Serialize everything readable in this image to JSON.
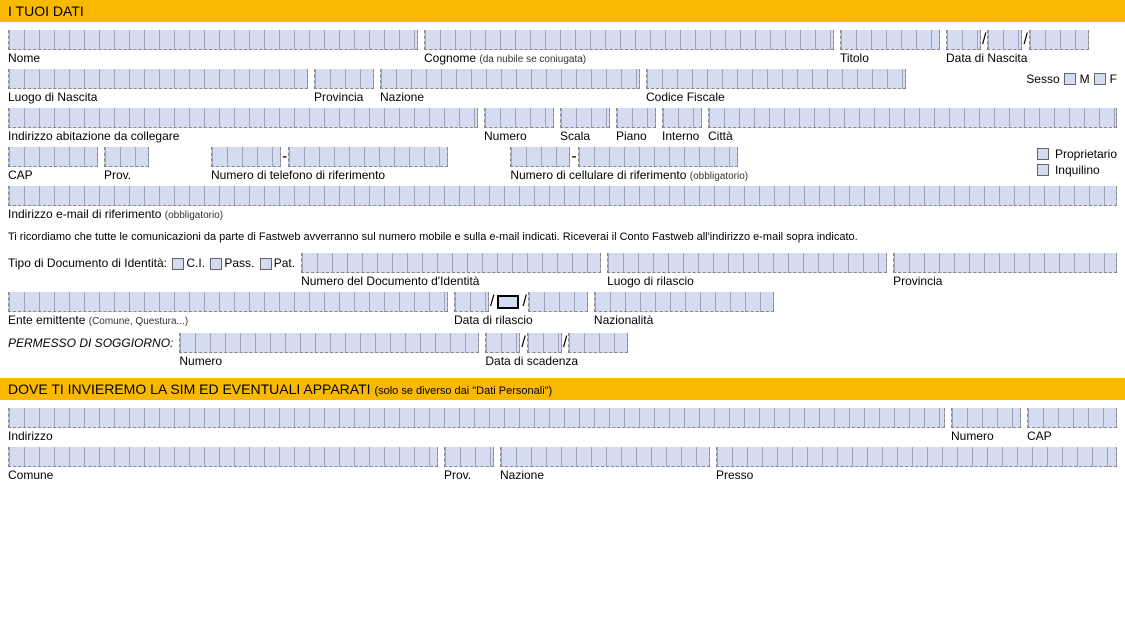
{
  "section1": {
    "title": "I TUOI DATI",
    "nome": "Nome",
    "cognome": "Cognome",
    "cognome_note": "(da nubile se coniugata)",
    "titolo": "Titolo",
    "data_nascita": "Data di Nascita",
    "luogo_nascita": "Luogo di Nascita",
    "provincia": "Provincia",
    "nazione": "Nazione",
    "codice_fiscale": "Codice Fiscale",
    "sesso": "Sesso",
    "sesso_m": "M",
    "sesso_f": "F",
    "indirizzo_abitazione": "Indirizzo abitazione da collegare",
    "numero": "Numero",
    "scala": "Scala",
    "piano": "Piano",
    "interno": "Interno",
    "citta": "Città",
    "cap": "CAP",
    "prov": "Prov.",
    "tel_rif": "Numero di telefono di riferimento",
    "cell_rif": "Numero di cellulare di riferimento",
    "obbligatorio": "(obbligatorio)",
    "proprietario": "Proprietario",
    "inquilino": "Inquilino",
    "email_rif": "Indirizzo e-mail di riferimento",
    "note": "Ti ricordiamo che tutte le comunicazioni da parte di Fastweb avverranno sul numero mobile e sulla e-mail indicati. Riceverai il Conto Fastweb all'indirizzo e-mail sopra indicato.",
    "tipo_doc": "Tipo di Documento di Identità:",
    "ci": "C.I.",
    "pass": "Pass.",
    "pat": "Pat.",
    "num_doc": "Numero del Documento d'Identità",
    "luogo_rilascio": "Luogo di rilascio",
    "provincia2": "Provincia",
    "ente": "Ente emittente",
    "ente_note": "(Comune, Questura...)",
    "data_rilascio": "Data di rilascio",
    "nazionalita": "Nazionalità",
    "permesso": "PERMESSO DI SOGGIORNO:",
    "numero2": "Numero",
    "scadenza": "Data di scadenza"
  },
  "section2": {
    "title": "DOVE TI INVIEREMO LA SIM ED EVENTUALI APPARATI",
    "subtitle": "(solo se diverso dai \"Dati Personali\")",
    "indirizzo": "Indirizzo",
    "numero": "Numero",
    "cap": "CAP",
    "comune": "Comune",
    "prov": "Prov.",
    "nazione": "Nazione",
    "presso": "Presso"
  }
}
